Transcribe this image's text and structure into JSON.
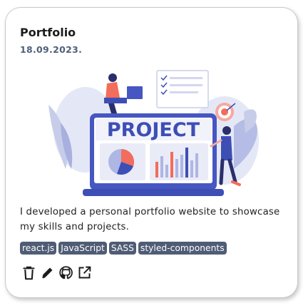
{
  "card": {
    "title": "Portfolio",
    "date": "18.09.2023.",
    "image_label": "PROJECT",
    "description": "I developed a personal portfolio website to showcase my skills and projects.",
    "tags": [
      "react.js",
      "JavaScript",
      "SASS",
      "styled-components"
    ],
    "actions": [
      {
        "icon": "trash-icon"
      },
      {
        "icon": "pencil-icon"
      },
      {
        "icon": "github-icon"
      },
      {
        "icon": "external-link-icon"
      }
    ]
  },
  "colors": {
    "tag_background": "#4f5c74",
    "date": "#4e5f78",
    "illustration_primary": "#3d4fb5",
    "illustration_accent": "#f26d5b"
  }
}
